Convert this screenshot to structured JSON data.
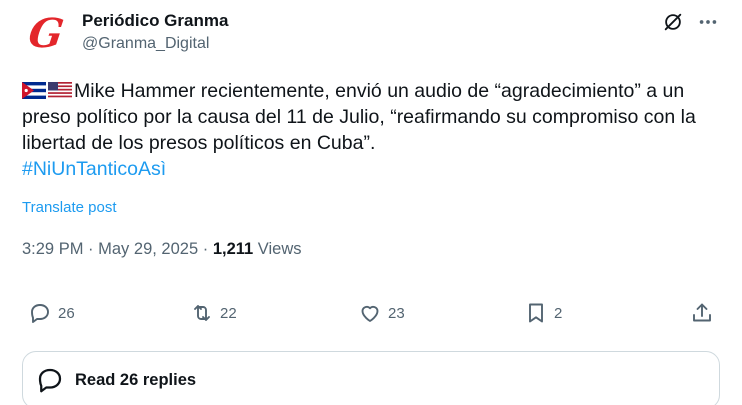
{
  "author": {
    "avatar_letter": "G",
    "avatar_color": "#e3262b",
    "name": "Periódico Granma",
    "handle": "@Granma_Digital"
  },
  "post": {
    "flags": [
      "cuba-flag-icon",
      "usa-flag-icon"
    ],
    "text": "Mike Hammer recientemente, envió un audio de “agradecimiento” a un preso político por la causa del 11 de Julio, “reafirmando su compromiso con la libertad de los presos políticos en Cuba”.",
    "hashtag": "#NiUnTanticoAsì",
    "translate_label": "Translate post"
  },
  "meta": {
    "time": "3:29 PM",
    "date": "May 29, 2025",
    "views_count": "1,211",
    "views_label": "Views"
  },
  "actions": {
    "replies": "26",
    "reposts": "22",
    "likes": "23",
    "bookmarks": "2"
  },
  "replies_button": {
    "label": "Read 26 replies"
  },
  "colors": {
    "link": "#1d9bf0",
    "secondary_text": "#536471",
    "border": "#cfd9de"
  }
}
